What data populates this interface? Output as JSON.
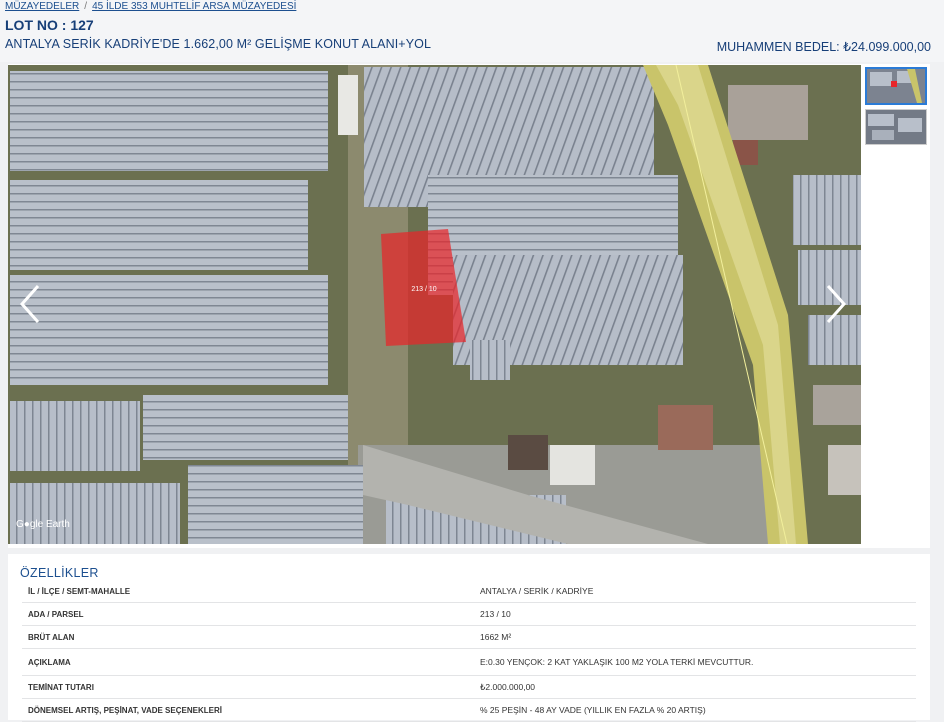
{
  "breadcrumb": {
    "items": [
      "MÜZAYEDELER",
      "45 İLDE 353 MUHTELİF ARSA MÜZAYEDESİ"
    ],
    "separator": "/"
  },
  "lot": {
    "label": "LOT NO : 127"
  },
  "listing": {
    "title": "ANTALYA SERİK KADRİYE'DE 1.662,00 M² GELİŞME KONUT ALANI+YOL",
    "bedel_label": "MUHAMMEN BEDEL:",
    "bedel_value": "₺24.099.000,00"
  },
  "gallery": {
    "parcel_label": "213 / 10",
    "watermark": "Google Earth",
    "watermark_visible": "G●gle Earth",
    "thumb_count": 2,
    "prev_icon": "chevron-left-icon",
    "next_icon": "chevron-right-icon",
    "highlight_color": "#e8262a"
  },
  "features": {
    "heading": "ÖZELLİKLER",
    "rows": [
      {
        "key": "İL / İLÇE / SEMT-MAHALLE",
        "value": "ANTALYA / SERİK / KADRİYE"
      },
      {
        "key": "ADA / PARSEL",
        "value": "213 / 10"
      },
      {
        "key": "BRÜT ALAN",
        "value": "1662 M²"
      },
      {
        "key": "AÇIKLAMA",
        "value": "E:0.30 YENÇOK: 2 KAT YAKLAŞIK 100 M2 YOLA TERKİ MEVCUTTUR."
      },
      {
        "key": "TEMİNAT TUTARI",
        "value": "₺2.000.000,00"
      },
      {
        "key": "DÖNEMSEL ARTIŞ, PEŞİNAT, VADE SEÇENEKLERİ",
        "value": "% 25 PEŞİN - 48 AY VADE (YILLIK EN FAZLA % 20 ARTIŞ)"
      }
    ]
  }
}
